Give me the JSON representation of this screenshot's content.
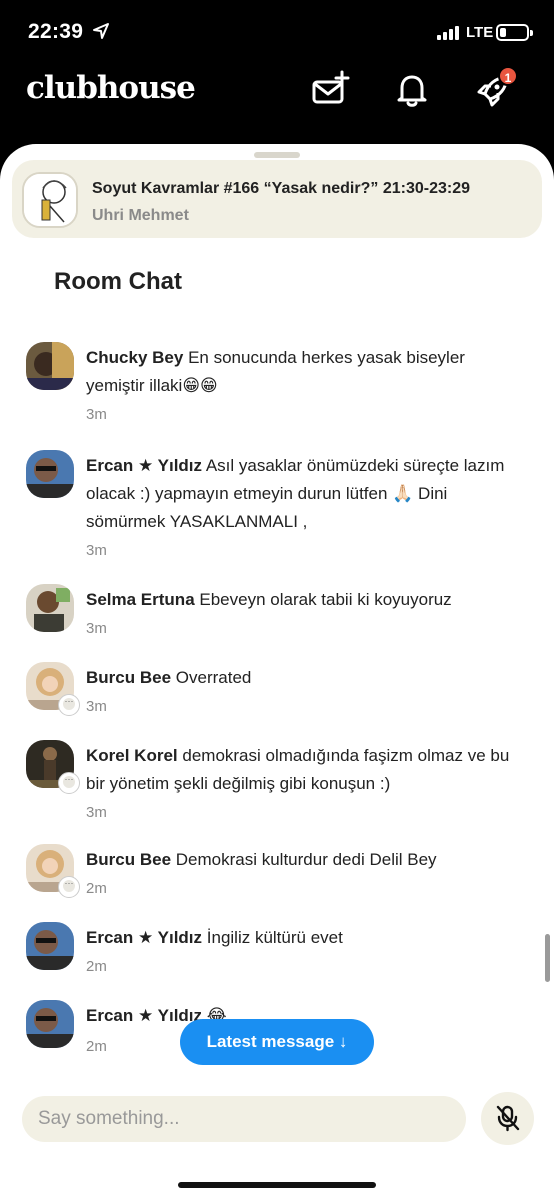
{
  "status_bar": {
    "time": "22:39",
    "network": "LTE"
  },
  "header": {
    "logo": "clubhouse",
    "icons": [
      "invite-mail-icon",
      "notification-bell-icon",
      "activity-rocket-icon"
    ],
    "activity_badge": "1"
  },
  "room": {
    "title": "Soyut Kavramlar #166 “Yasak nedir?” 21:30-23:29",
    "host": "Uhri Mehmet"
  },
  "chat": {
    "heading": "Room Chat",
    "messages": [
      {
        "name": "Chucky Bey",
        "text": "En sonucunda herkes yasak biseyler yemiştir illaki😁😁",
        "time": "3m"
      },
      {
        "name": "Ercan ★ Yıldız",
        "text": "Asıl yasaklar önümüzdeki süreçte lazım olacak :) yapmayın etmeyin durun lütfen 🙏🏻 Dini sömürmek YASAKLANMALI ,",
        "time": "3m"
      },
      {
        "name": "Selma Ertuna",
        "text": "Ebeveyn olarak tabii ki koyuyoruz",
        "time": "3m"
      },
      {
        "name": "Burcu Bee",
        "text": "Overrated",
        "time": "3m"
      },
      {
        "name": "Korel Korel",
        "text": "demokrasi olmadığında faşizm olmaz ve bu bir yönetim şekli değilmiş gibi konuşun :)",
        "time": "3m"
      },
      {
        "name": "Burcu Bee",
        "text": "Demokrasi kulturdur dedi Delil Bey",
        "time": "2m"
      },
      {
        "name": "Ercan ★ Yıldız",
        "text": "İngiliz kültürü evet",
        "time": "2m"
      },
      {
        "name": "Ercan ★ Yıldız",
        "text": "😂",
        "time": "2m"
      }
    ]
  },
  "latest_button": "Latest message ↓",
  "composer": {
    "placeholder": "Say something..."
  }
}
